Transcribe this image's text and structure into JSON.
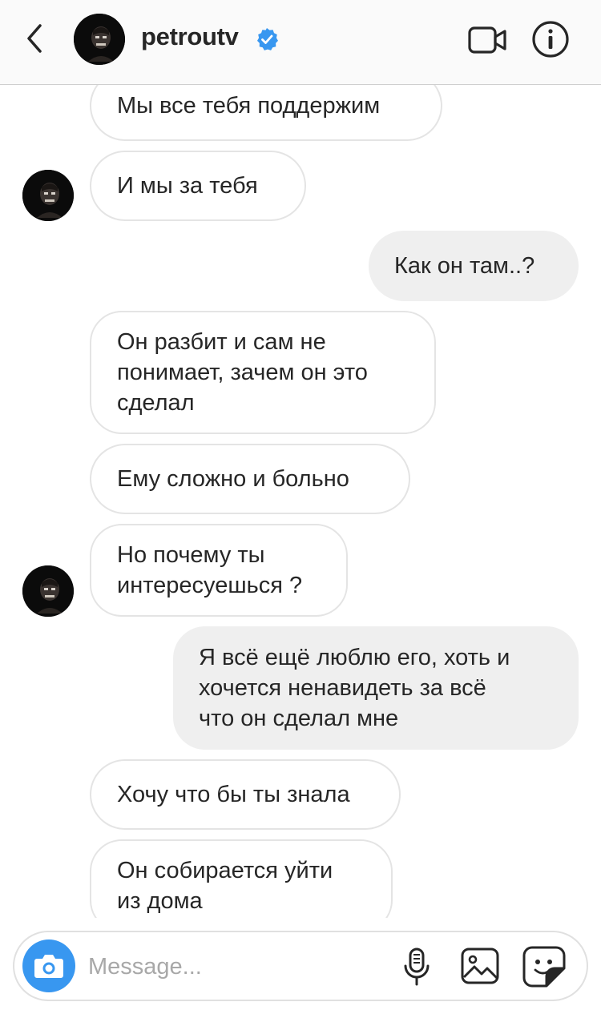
{
  "header": {
    "username": "petroutv",
    "icons": {
      "back": "chevron-left-icon",
      "verified": "verified-badge-icon",
      "video": "video-camera-icon",
      "info": "info-icon"
    },
    "colors": {
      "verified": "#3897f0"
    }
  },
  "messages": [
    {
      "sender": "petroutv",
      "text": "Мы все тебя поддержим"
    },
    {
      "sender": "petroutv",
      "text": "И мы за тебя"
    },
    {
      "sender": "me",
      "text": "Как он там..?"
    },
    {
      "sender": "petroutv",
      "text": "Он разбит и сам не\nпонимает, зачем он это\nсделал"
    },
    {
      "sender": "petroutv",
      "text": "Ему сложно и больно"
    },
    {
      "sender": "petroutv",
      "text": "Но почему ты\nинтересуешься ?"
    },
    {
      "sender": "me",
      "text": "Я всё ещё люблю его, хоть и\nхочется ненавидеть за всё\nчто он сделал мне"
    },
    {
      "sender": "petroutv",
      "text": "Хочу что бы ты знала"
    },
    {
      "sender": "petroutv",
      "text": "Он собирается уйти\nиз дома"
    }
  ],
  "composer": {
    "placeholder": "Message...",
    "value": "",
    "icons": {
      "camera": "camera-icon",
      "mic": "microphone-icon",
      "gallery": "image-gallery-icon",
      "sticker": "sticker-icon"
    },
    "colors": {
      "camera_button": "#3897f0"
    }
  },
  "colors": {
    "incoming_border": "#e4e4e4",
    "outgoing_bg": "#efefef",
    "text": "#262626",
    "placeholder": "#a8a8a8"
  }
}
